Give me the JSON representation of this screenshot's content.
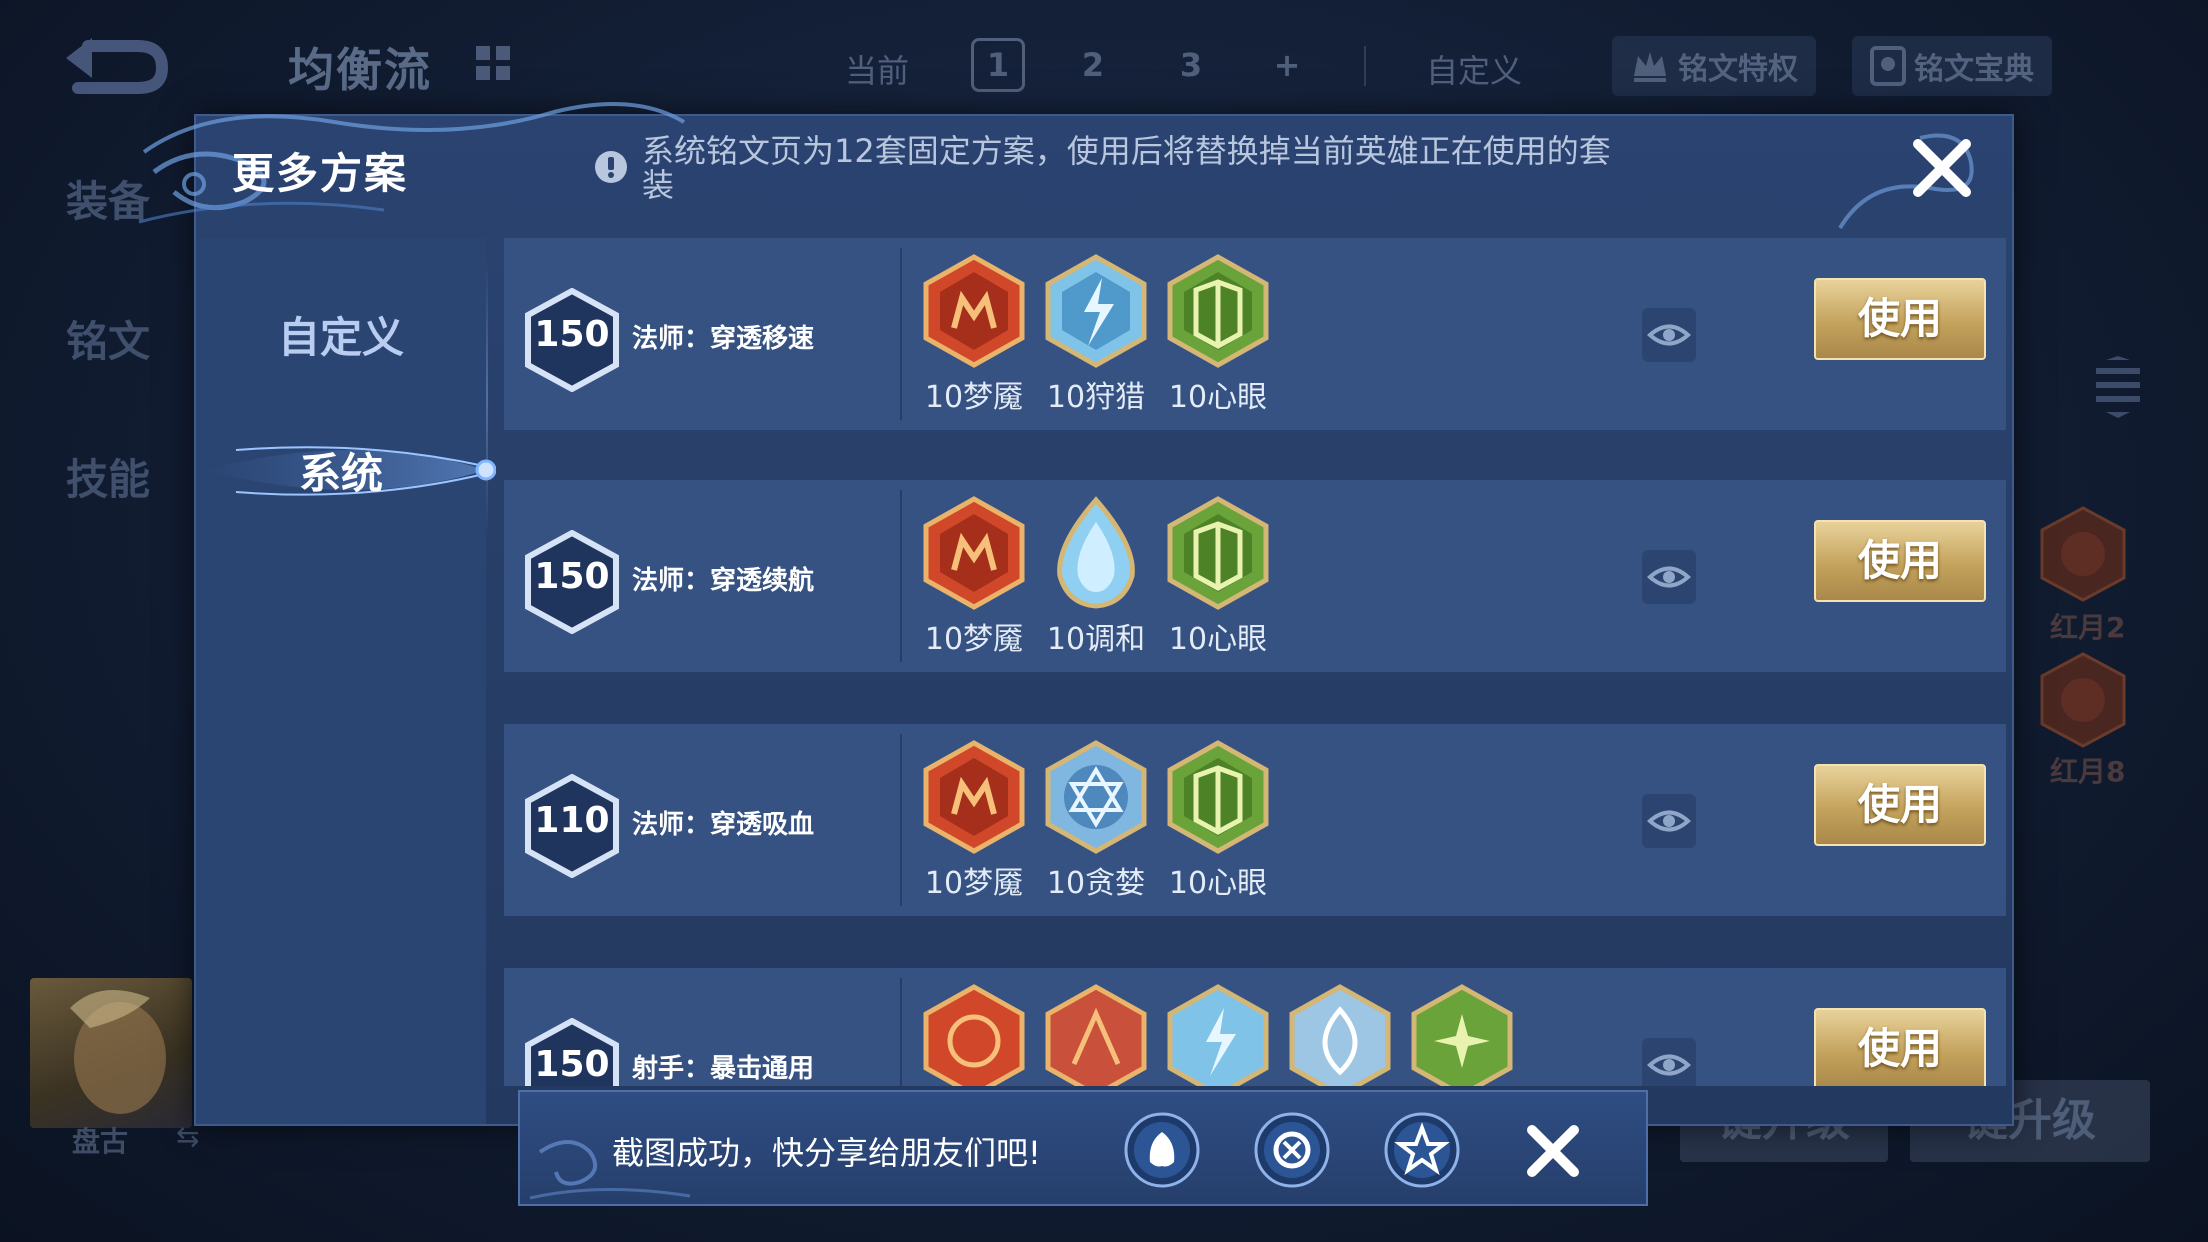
{
  "topbar": {
    "build_name": "均衡流",
    "current_label": "当前",
    "pages": [
      "1",
      "2",
      "3",
      "+"
    ],
    "active_page": "1",
    "custom_label": "自定义",
    "privilege_label": "铭文特权",
    "codex_label": "铭文宝典"
  },
  "left_nav": [
    "装备",
    "铭文",
    "技能"
  ],
  "hero": {
    "name": "盘古",
    "swap_icon": "⇆"
  },
  "side_runes": [
    "红月2",
    "红月8"
  ],
  "background_buttons": [
    "键升级",
    "键升级"
  ],
  "modal": {
    "title": "更多方案",
    "info_text": "系统铭文页为12套固定方案，使用后将替换掉当前英雄正在使用的套装",
    "tabs": {
      "custom": "自定义",
      "system": "系统"
    },
    "active_tab": "系统"
  },
  "rows": [
    {
      "level": "150",
      "name": "法师：穿透移速",
      "runes": [
        {
          "label": "10梦魇",
          "color": "#d0472a",
          "icon": "nightmare-rune-icon"
        },
        {
          "label": "10狩猎",
          "color": "#7fc4e8",
          "icon": "hunt-rune-icon"
        },
        {
          "label": "10心眼",
          "color": "#6aa33a",
          "icon": "mind-eye-rune-icon"
        }
      ],
      "action": "使用"
    },
    {
      "level": "150",
      "name": "法师：穿透续航",
      "runes": [
        {
          "label": "10梦魇",
          "color": "#d0472a",
          "icon": "nightmare-rune-icon"
        },
        {
          "label": "10调和",
          "color": "#8fd0f2",
          "icon": "harmony-rune-icon"
        },
        {
          "label": "10心眼",
          "color": "#6aa33a",
          "icon": "mind-eye-rune-icon"
        }
      ],
      "action": "使用"
    },
    {
      "level": "110",
      "name": "法师：穿透吸血",
      "runes": [
        {
          "label": "10梦魇",
          "color": "#d0472a",
          "icon": "nightmare-rune-icon"
        },
        {
          "label": "10贪婪",
          "color": "#7fb7e0",
          "icon": "greed-rune-icon"
        },
        {
          "label": "10心眼",
          "color": "#6aa33a",
          "icon": "mind-eye-rune-icon"
        }
      ],
      "action": "使用"
    },
    {
      "level": "150",
      "name": "射手：暴击通用",
      "runes": [
        {
          "label": "",
          "color": "#d0472a",
          "icon": "red-rune-icon"
        },
        {
          "label": "",
          "color": "#c9503a",
          "icon": "red-rune-icon"
        },
        {
          "label": "",
          "color": "#7fc4e8",
          "icon": "hunt-rune-icon"
        },
        {
          "label": "",
          "color": "#9cc6e4",
          "icon": "blue-rune-icon"
        },
        {
          "label": "",
          "color": "#6aa33a",
          "icon": "green-rune-icon"
        }
      ],
      "action": "使用"
    }
  ],
  "toast": {
    "text": "截图成功，快分享给朋友们吧!",
    "share_targets": [
      "qq-icon",
      "wechat-moments-icon",
      "qzone-icon"
    ]
  },
  "colors": {
    "gold_button": "#c4a35d",
    "modal_bg": "#24395f",
    "row_bg": "#365282"
  }
}
